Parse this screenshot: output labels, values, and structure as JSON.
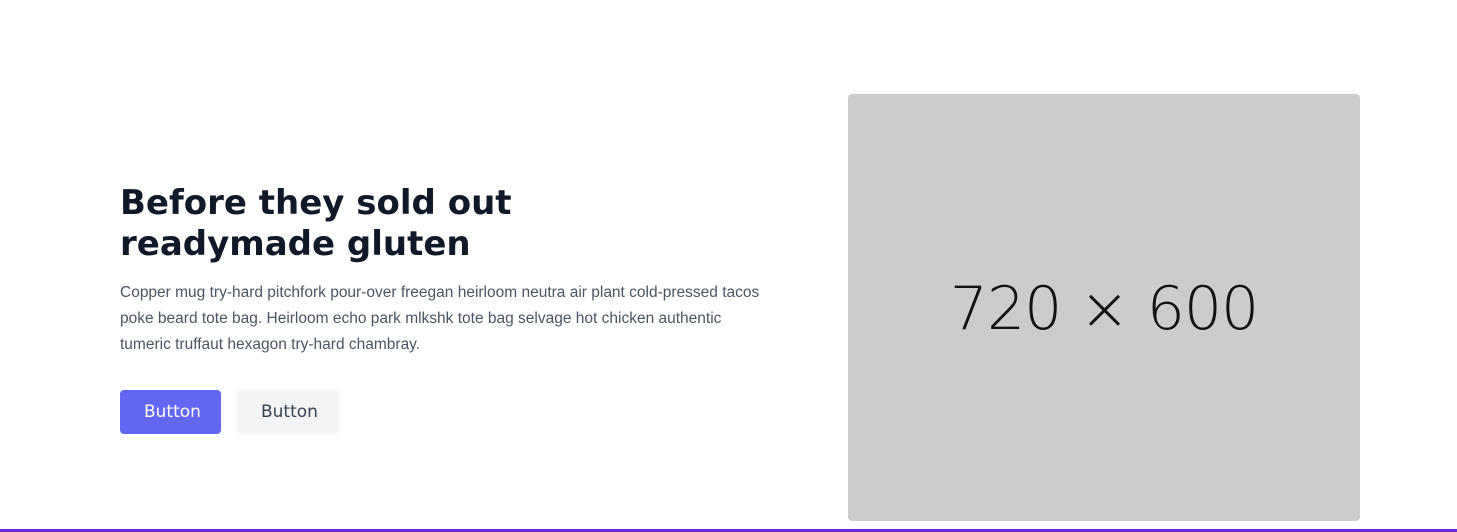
{
  "hero": {
    "title_line1": "Before they sold out",
    "title_line2": "readymade gluten",
    "description": "Copper mug try-hard pitchfork pour-over freegan heirloom neutra air plant cold-pressed tacos poke beard tote bag. Heirloom echo park mlkshk tote bag selvage hot chicken authentic tumeric truffaut hexagon try-hard chambray.",
    "primary_button": "Button",
    "secondary_button": "Button"
  },
  "image_placeholder": {
    "label": "720 × 600",
    "background": "#cccccc"
  },
  "colors": {
    "accent": "#6366f1",
    "secondary_button_bg": "#f3f4f6",
    "bottom_rule": "#6d28d9"
  }
}
